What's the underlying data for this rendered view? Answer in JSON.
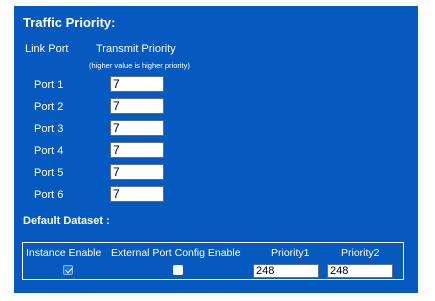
{
  "traffic_priority": {
    "title": "Traffic Priority:",
    "link_port_header": "Link Port",
    "transmit_priority_header": "Transmit Priority",
    "note": "(higher value is higher priority)",
    "ports": [
      {
        "label": "Port 1",
        "value": "7"
      },
      {
        "label": "Port 2",
        "value": "7"
      },
      {
        "label": "Port 3",
        "value": "7"
      },
      {
        "label": "Port 4",
        "value": "7"
      },
      {
        "label": "Port 5",
        "value": "7"
      },
      {
        "label": "Port 6",
        "value": "7"
      }
    ]
  },
  "default_dataset": {
    "title": "Default Dataset :",
    "columns": [
      "Instance Enable",
      "External Port Config Enable",
      "Priority1",
      "Priority2"
    ],
    "instance_enable": true,
    "external_port_config_enable": false,
    "priority1": "248",
    "priority2": "248"
  },
  "colors": {
    "panel_background": "#0559bf",
    "text": "#ffffff"
  }
}
